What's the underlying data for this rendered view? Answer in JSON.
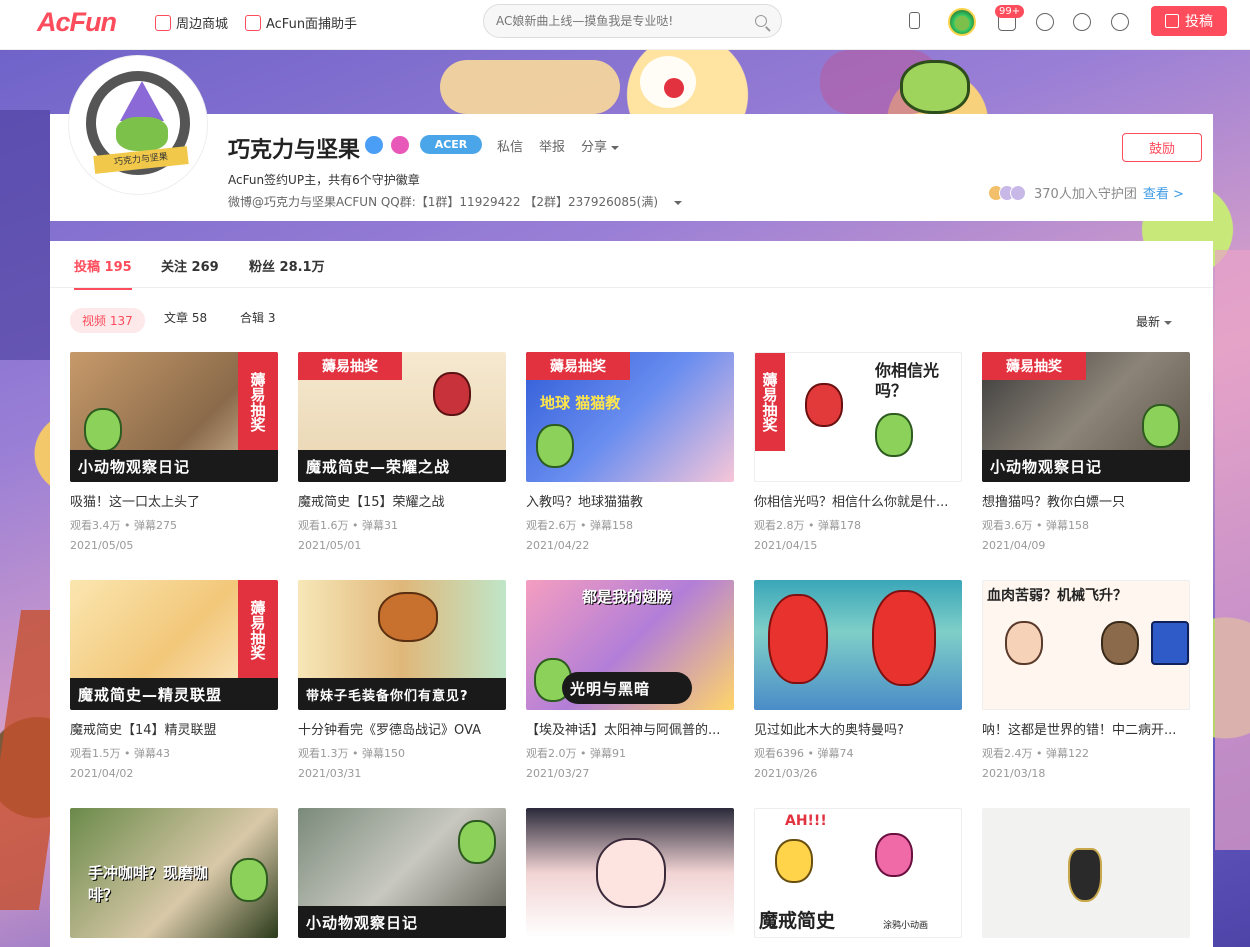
{
  "nav": {
    "logo": "AcFun",
    "links": [
      "周边商城",
      "AcFun面捕助手"
    ],
    "search_placeholder": "AC娘新曲上线—摸鱼我是专业哒!",
    "msg_badge": "99+",
    "post_label": "投稿"
  },
  "profile": {
    "name": "巧克力与坚果",
    "acer_badge": "ACER",
    "actions": [
      "私信",
      "举报",
      "分享"
    ],
    "intro1": "AcFun签约UP主，共有6个守护徽章",
    "intro2": "微博@巧克力与坚果ACFUN  QQ群:【1群】11929422 【2群】237926085(满)",
    "avatar_ribbon": "巧克力与坚果",
    "cheer_label": "鼓励",
    "guard_text": "370人加入守护团",
    "guard_more": "查看 >"
  },
  "tabs": [
    {
      "label": "投稿 195"
    },
    {
      "label": "关注 269"
    },
    {
      "label": "粉丝 28.1万"
    }
  ],
  "subtabs": [
    {
      "label": "视频 137"
    },
    {
      "label": "文章 58"
    },
    {
      "label": "合辑 3"
    }
  ],
  "sort_label": "最新",
  "colors": {
    "accent": "#fd4c5b"
  },
  "videos": [
    {
      "title": "吸猫！这一口太上头了",
      "stats": "观看3.4万 • 弹幕275",
      "date": "2021/05/05",
      "banner": "小动物观察日记",
      "tag": "薅易抽奖"
    },
    {
      "title": "魔戒简史【15】荣耀之战",
      "stats": "观看1.6万 • 弹幕31",
      "date": "2021/05/01",
      "banner": "魔戒简史—荣耀之战",
      "top_tag": "薅易抽奖"
    },
    {
      "title": "入教吗？地球猫猫教",
      "stats": "观看2.6万 • 弹幕158",
      "date": "2021/04/22",
      "top_tag": "薅易抽奖",
      "overlay": "地球 猫猫教"
    },
    {
      "title": "你相信光吗？相信什么你就是什...",
      "stats": "观看2.8万 • 弹幕178",
      "date": "2021/04/15",
      "side_tag": "薅易抽奖",
      "overlay": "你相信光吗？"
    },
    {
      "title": "想撸猫吗？教你白嫖一只",
      "stats": "观看3.6万 • 弹幕158",
      "date": "2021/04/09",
      "banner": "小动物观察日记",
      "top_tag": "薅易抽奖"
    },
    {
      "title": "魔戒简史【14】精灵联盟",
      "stats": "观看1.5万 • 弹幕43",
      "date": "2021/04/02",
      "banner": "魔戒简史—精灵联盟",
      "tag": "薅易抽奖"
    },
    {
      "title": "十分钟看完《罗德岛战记》OVA",
      "stats": "观看1.3万 • 弹幕150",
      "date": "2021/03/31",
      "banner": "带妹子毛装备你们有意见?"
    },
    {
      "title": "【埃及神话】太阳神与阿佩普的...",
      "stats": "观看2.0万 • 弹幕91",
      "date": "2021/03/27",
      "banner": "光明与黑暗",
      "overlay": "都是我的翅膀"
    },
    {
      "title": "见过如此木大的奥特曼吗?",
      "stats": "观看6396 • 弹幕74",
      "date": "2021/03/26"
    },
    {
      "title": "呐！这都是世界的错！中二病开...",
      "stats": "观看2.4万 • 弹幕122",
      "date": "2021/03/18",
      "overlay": "血肉苦弱？机械飞升？"
    },
    {
      "overlay": "手冲咖啡？现磨咖啡？"
    },
    {
      "banner": "小动物观察日记"
    },
    {},
    {
      "banner": "魔戒简史",
      "overlay": "AH!!!",
      "sub": "涂鸦小动画"
    },
    {}
  ]
}
